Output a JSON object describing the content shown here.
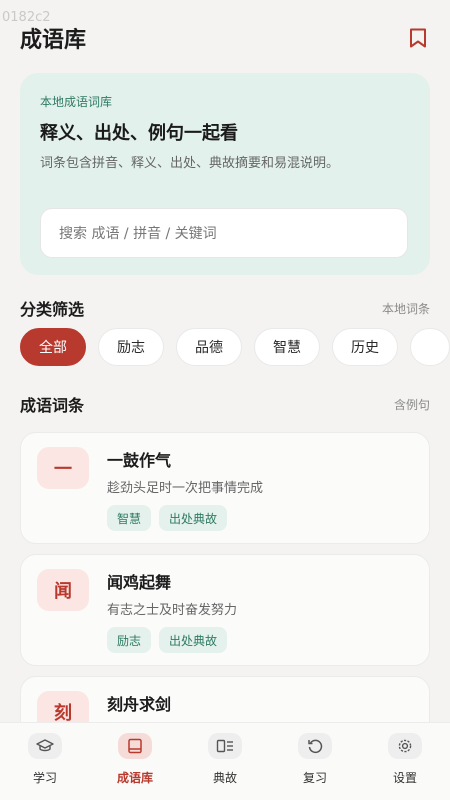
{
  "status": {
    "text": "0182c2"
  },
  "header": {
    "title": "成语库"
  },
  "hero": {
    "eyebrow": "本地成语词库",
    "title": "释义、出处、例句一起看",
    "description": "词条包含拼音、释义、出处、典故摘要和易混说明。",
    "search_placeholder": "搜索 成语 / 拼音 / 关键词"
  },
  "filters": {
    "title": "分类筛选",
    "note": "本地词条",
    "chips": [
      "全部",
      "励志",
      "品德",
      "智慧",
      "历史"
    ]
  },
  "entries": {
    "title": "成语词条",
    "note": "含例句",
    "items": [
      {
        "char": "一",
        "title": "一鼓作气",
        "desc": "趁劲头足时一次把事情完成",
        "tags": [
          "智慧",
          "出处典故"
        ]
      },
      {
        "char": "闻",
        "title": "闻鸡起舞",
        "desc": "有志之士及时奋发努力",
        "tags": [
          "励志",
          "出处典故"
        ]
      },
      {
        "char": "刻",
        "title": "刻舟求剑",
        "desc": "",
        "tags": []
      }
    ]
  },
  "tabbar": {
    "items": [
      {
        "label": "学习",
        "icon": "graduation-cap-icon"
      },
      {
        "label": "成语库",
        "icon": "book-icon"
      },
      {
        "label": "典故",
        "icon": "scroll-icon"
      },
      {
        "label": "复习",
        "icon": "refresh-icon"
      },
      {
        "label": "设置",
        "icon": "gear-icon"
      }
    ],
    "active": "成语库"
  },
  "colors": {
    "accent": "#b83a2e",
    "mint": "#e3f1ec",
    "tag_text": "#2f7a64"
  }
}
